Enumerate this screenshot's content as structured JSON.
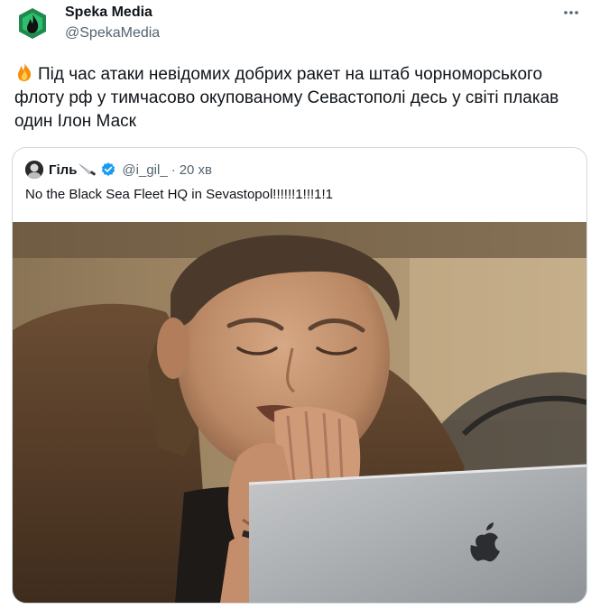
{
  "author": {
    "name": "Speka Media",
    "handle": "@SpekaMedia",
    "avatar_icon": "speka-flame-logo"
  },
  "more_icon": "more-horizontal-icon",
  "tweet": {
    "emoji_icon": "fire-emoji-icon",
    "text": "Під час атаки невідомих добрих ракет на штаб чорноморського флоту рф у тимчасово окупованому Севастополі десь у світі плакав один Ілон Маск"
  },
  "quoted_tweet": {
    "name": "Гіль",
    "name_emoji": "knife-emoji-icon",
    "verified_icon": "verified-badge-icon",
    "handle": "@i_gil_",
    "separator": "·",
    "time": "20 хв",
    "text": "No the Black Sea Fleet HQ in Sevastopol!!!!!!1!!!1!1",
    "media": "crying-man-at-laptop-photo"
  },
  "colors": {
    "text": "#0f1419",
    "secondary": "#536471",
    "border": "#cfd9de",
    "verified": "#1d9bf0",
    "logo_green": "#2fbf71"
  }
}
